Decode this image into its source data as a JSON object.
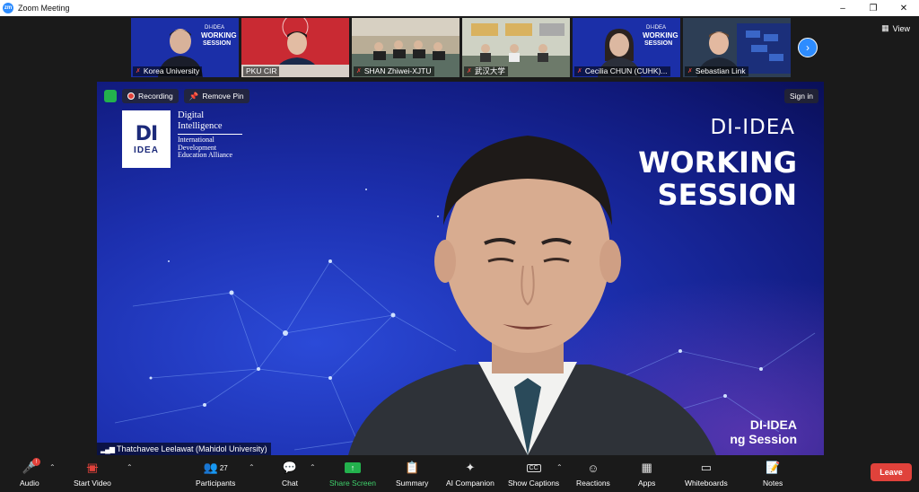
{
  "window": {
    "app_icon": "zm",
    "title": "Zoom Meeting",
    "controls": [
      "minimize",
      "restore",
      "close"
    ]
  },
  "thumbnails": [
    {
      "name": "Korea University",
      "muted": true,
      "bg": "#1b2fa8"
    },
    {
      "name": "PKU CIR",
      "muted": false,
      "bg": "#c92a33"
    },
    {
      "name": "SHAN Zhiwei-XJTU",
      "muted": true,
      "bg": "#8a7a63"
    },
    {
      "name": "武汉大学",
      "muted": true,
      "bg": "#9aa08f"
    },
    {
      "name": "Cecilia CHUN (CUHK)...",
      "muted": true,
      "bg": "#1b2fa8"
    },
    {
      "name": "Sebastian Link",
      "muted": true,
      "bg": "#3b4d63"
    }
  ],
  "thumb_labels": {
    "brand_small": "DI-IDEA",
    "working": "WORKING",
    "session": "SESSION"
  },
  "view_label": "View",
  "main": {
    "recording_label": "Recording",
    "remove_pin_label": "Remove Pin",
    "sign_in_label": "Sign in",
    "logo": {
      "mark_top": "DI",
      "mark_bottom": "IDEA",
      "line1": "Digital",
      "line2": "Intelligence",
      "line3": "International",
      "line4": "Development",
      "line5": "Education Alliance"
    },
    "title": "DI-IDEA",
    "working_line1": "WORKING",
    "working_line2": "SESSION",
    "bottom_line1": "DI-IDEA",
    "bottom_line2": "ng Session",
    "speaker_name": "Thatchavee Leelawat (Mahidol University)"
  },
  "toolbar": {
    "audio": "Audio",
    "start_video": "Start Video",
    "participants": "Participants",
    "participants_count": "27",
    "chat": "Chat",
    "share_screen": "Share Screen",
    "summary": "Summary",
    "ai_companion": "AI Companion",
    "show_captions": "Show Captions",
    "captions_badge": "CC",
    "reactions": "Reactions",
    "apps": "Apps",
    "whiteboards": "Whiteboards",
    "notes": "Notes",
    "leave": "Leave",
    "audio_badge": "!"
  },
  "colors": {
    "zoom_blue": "#2d8cff",
    "leave_red": "#e0423b",
    "share_green": "#23b14d"
  }
}
